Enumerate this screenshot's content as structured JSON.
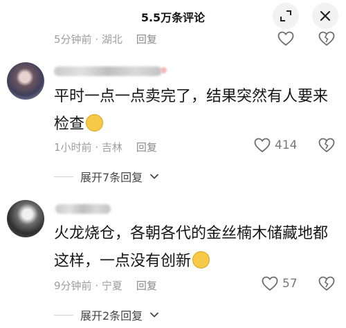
{
  "header": {
    "title": "5.5万条评论"
  },
  "top_comment": {
    "time": "5分钟前",
    "location": "湖北",
    "reply": "回复"
  },
  "comments": [
    {
      "text": "平时一点一点卖完了，结果突然有人要来检查",
      "emoji": "shy-face-icon",
      "time": "1小时前",
      "location": "吉林",
      "reply": "回复",
      "likes": "414",
      "expand": "展开7条回复"
    },
    {
      "text": "火龙烧仓，各朝各代的金丝楠木储藏地都这样，一点没有创新",
      "emoji": "laughing-tears-icon",
      "time": "9分钟前",
      "location": "宁夏",
      "reply": "回复",
      "likes": "57",
      "expand": "展开2条回复"
    }
  ],
  "colors": {
    "meta": "#9d9d9d",
    "text": "#161616",
    "button_bg": "#f2f2f2"
  }
}
